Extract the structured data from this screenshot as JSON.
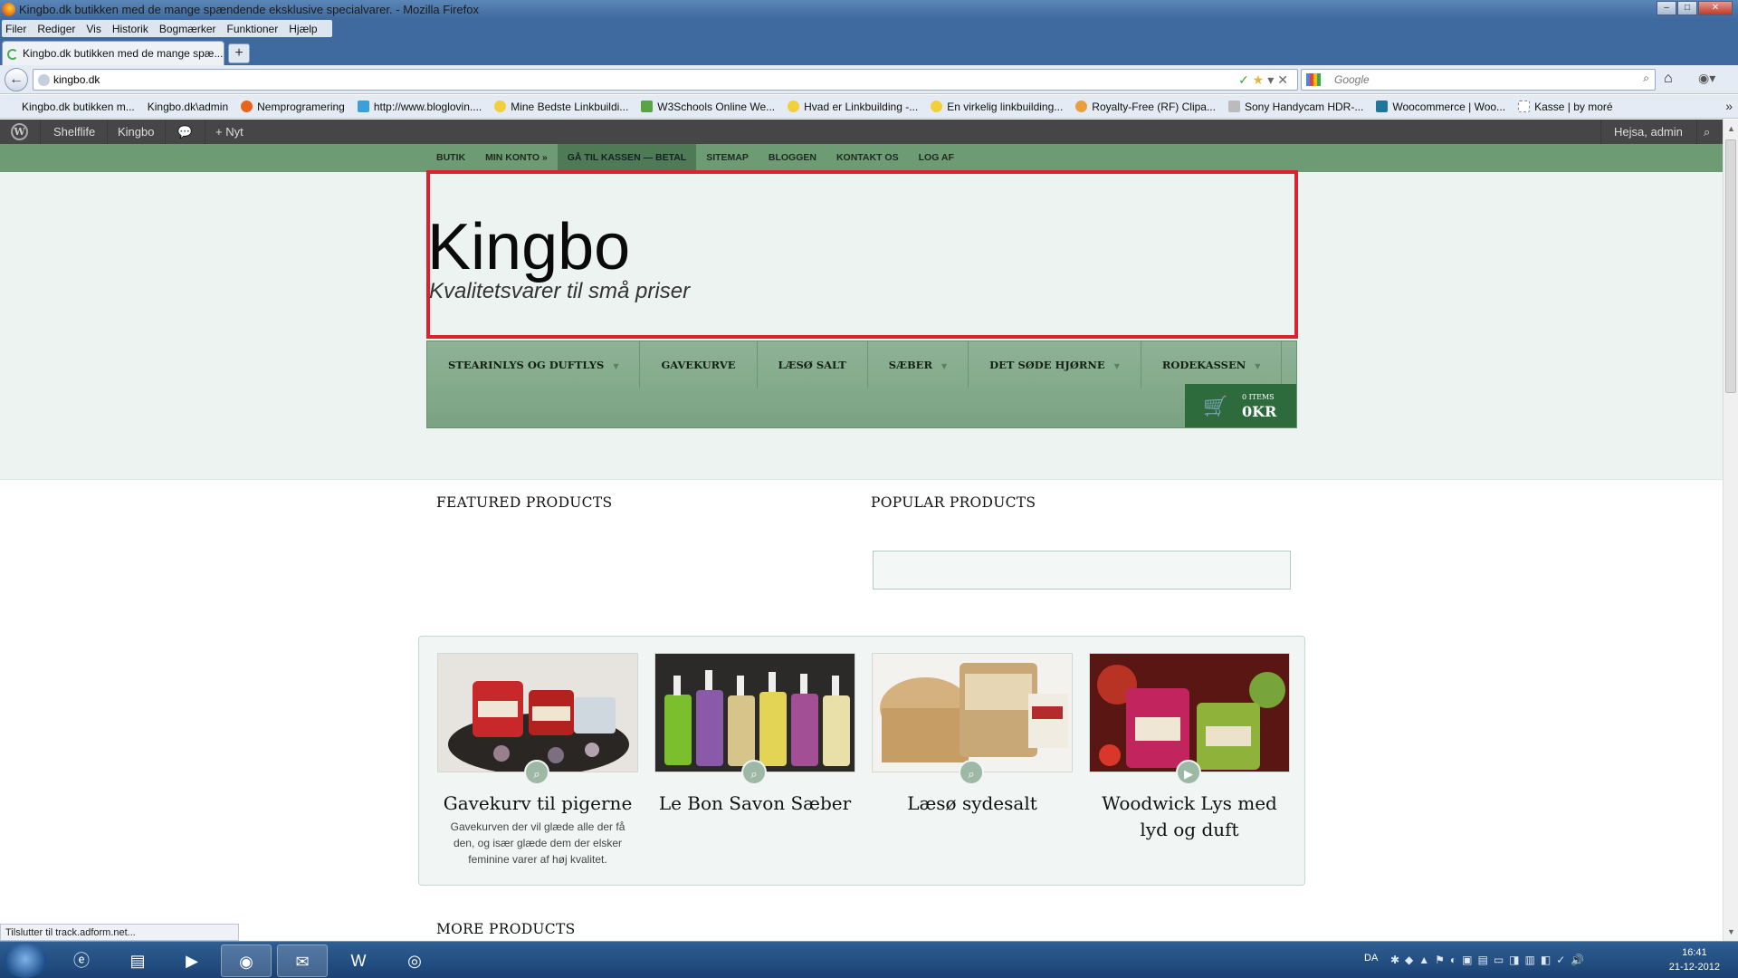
{
  "window": {
    "title": "Kingbo.dk butikken med de mange spændende eksklusive specialvarer. - Mozilla Firefox"
  },
  "menubar": [
    "Filer",
    "Rediger",
    "Vis",
    "Historik",
    "Bogmærker",
    "Funktioner",
    "Hjælp"
  ],
  "tab": {
    "label": "Kingbo.dk butikken med de mange spæ...",
    "new_tab_label": "+"
  },
  "nav": {
    "url": "kingbo.dk",
    "search_placeholder": "Google"
  },
  "bookmarks": [
    {
      "label": "Kingbo.dk butikken m...",
      "color": "#e4ebf4"
    },
    {
      "label": "Kingbo.dk\\admin",
      "color": "#e4ebf4"
    },
    {
      "label": "Nemprogramering",
      "color": "#e8641c"
    },
    {
      "label": "http://www.bloglovin....",
      "color": "#3aa0dc"
    },
    {
      "label": "Mine Bedste Linkbuildi...",
      "color": "#f2d03b"
    },
    {
      "label": "W3Schools Online We...",
      "color": "#59a545"
    },
    {
      "label": "Hvad er Linkbuilding -...",
      "color": "#f2d03b"
    },
    {
      "label": "En virkelig linkbuilding...",
      "color": "#f2d03b"
    },
    {
      "label": "Royalty-Free (RF) Clipa...",
      "color": "#e8a03b"
    },
    {
      "label": "Sony Handycam HDR-...",
      "color": "#bbbbbb"
    },
    {
      "label": "Woocommerce | Woo...",
      "color": "#21759b"
    },
    {
      "label": "Kasse | by moré",
      "color": "#ffffff"
    }
  ],
  "wpbar": {
    "items": [
      "Shelflife",
      "Kingbo",
      "Nyt"
    ],
    "greeting": "Hejsa, admin"
  },
  "topmenu": [
    {
      "label": "BUTIK",
      "active": false
    },
    {
      "label": "MIN KONTO »",
      "active": false
    },
    {
      "label": "GÅ TIL KASSEN — BETAL",
      "active": true
    },
    {
      "label": "SITEMAP",
      "active": false
    },
    {
      "label": "BLOGGEN",
      "active": false
    },
    {
      "label": "KONTAKT OS",
      "active": false
    },
    {
      "label": "LOG AF",
      "active": false
    }
  ],
  "header": {
    "site_title": "Kingbo",
    "tagline": "Kvalitetsvarer til små priser"
  },
  "mainnav": [
    {
      "label": "STEARINLYS OG DUFTLYS",
      "has_dropdown": true
    },
    {
      "label": "GAVEKURVE",
      "has_dropdown": false
    },
    {
      "label": "LÆSØ SALT",
      "has_dropdown": false
    },
    {
      "label": "SÆBER",
      "has_dropdown": true
    },
    {
      "label": "DET SØDE HJØRNE",
      "has_dropdown": true
    },
    {
      "label": "RODEKASSEN",
      "has_dropdown": true
    }
  ],
  "cart": {
    "items_label": "0 ITEMS",
    "total": "0KR"
  },
  "sections": {
    "featured": "FEATURED PRODUCTS",
    "popular": "POPULAR PRODUCTS",
    "more": "MORE PRODUCTS"
  },
  "products": [
    {
      "name": "Gavekurv til pigerne",
      "desc": "Gavekurven der vil glæde alle der få den, og især glæde dem der elsker feminine varer af høj kvalitet.",
      "icon": "zoom-icon"
    },
    {
      "name": "Le Bon Savon Sæber",
      "desc": "",
      "icon": "zoom-icon"
    },
    {
      "name": "Læsø sydesalt",
      "desc": "",
      "icon": "zoom-icon"
    },
    {
      "name": "Woodwick Lys med lyd og duft",
      "desc": "",
      "icon": "play-icon"
    }
  ],
  "status": "Tilslutter til track.adform.net...",
  "taskbar": {
    "lang": "DA",
    "time": "16:41",
    "date": "21-12-2012"
  }
}
